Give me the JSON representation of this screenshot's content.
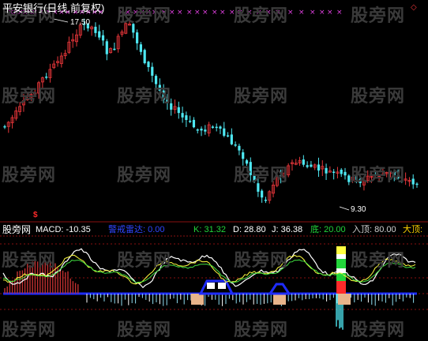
{
  "header": {
    "title": "平安银行(日线,前复权)"
  },
  "price_labels": {
    "high": "17.50",
    "low": "9.30"
  },
  "watermark": "股旁网",
  "indicator_header": [
    {
      "text": "股旁网",
      "color": "#ffffff"
    },
    {
      "text": "MACD: -10.35",
      "color": "#ffffff"
    },
    {
      "text": "警戒雷达: 0.00",
      "color": "#2f46ff"
    },
    {
      "text": "K: 31.32",
      "color": "#22d43a"
    },
    {
      "text": "D: 28.80",
      "color": "#ffffff"
    },
    {
      "text": "J: 36.38",
      "color": "#ffffff"
    },
    {
      "text": "底: 20.00",
      "color": "#22d43a"
    },
    {
      "text": "入顶: 80.00",
      "color": "#cfcfcf"
    },
    {
      "text": "大顶:",
      "color": "#ffd400"
    }
  ],
  "signal_marker": "$",
  "colors": {
    "up": "#e8363a",
    "down": "#4ee8f2",
    "marker": "#e040e0",
    "grid": "#8a1010",
    "k": "#ffffff",
    "d": "#ffff40",
    "j": "#40e040",
    "axis": "#1e2cff",
    "peach": "#e8b48a"
  }
}
